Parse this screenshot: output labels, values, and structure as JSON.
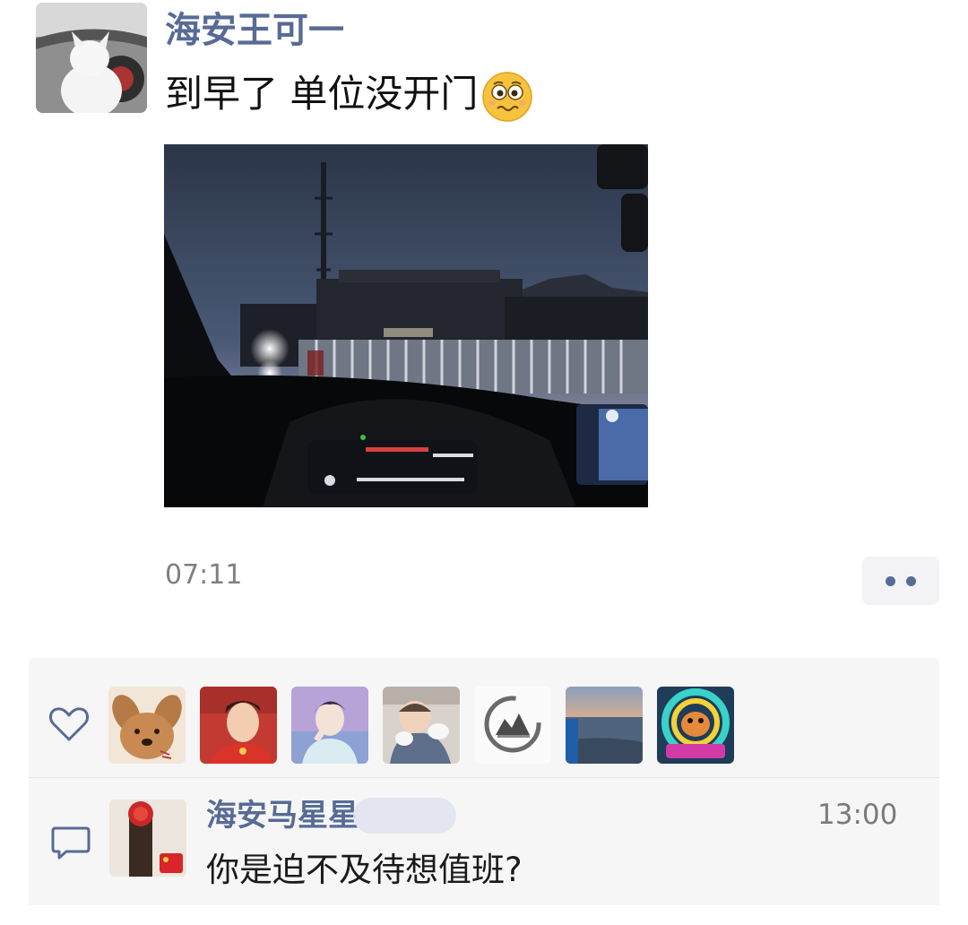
{
  "post": {
    "author": "海安王可一",
    "text": "到早了 单位没开门",
    "emoji": "woozy-face-emoji",
    "time": "07:11",
    "photo": "car-dashboard-at-dawn-photo"
  },
  "likes": {
    "avatars": [
      {
        "name": "cartoon-dog-avatar"
      },
      {
        "name": "boy-red-outfit-avatar"
      },
      {
        "name": "anime-boy-avatar"
      },
      {
        "name": "baby-avatar"
      },
      {
        "name": "ink-landscape-avatar"
      },
      {
        "name": "sunset-beach-avatar"
      },
      {
        "name": "neon-cartoon-avatar"
      }
    ]
  },
  "comment": {
    "author": "海安马星星",
    "time": "13:00",
    "text": "你是迫不及待想值班?"
  },
  "colors": {
    "name_link": "#576b95",
    "panel_bg": "#f6f6f6",
    "meta_text": "#7f7f7f"
  }
}
